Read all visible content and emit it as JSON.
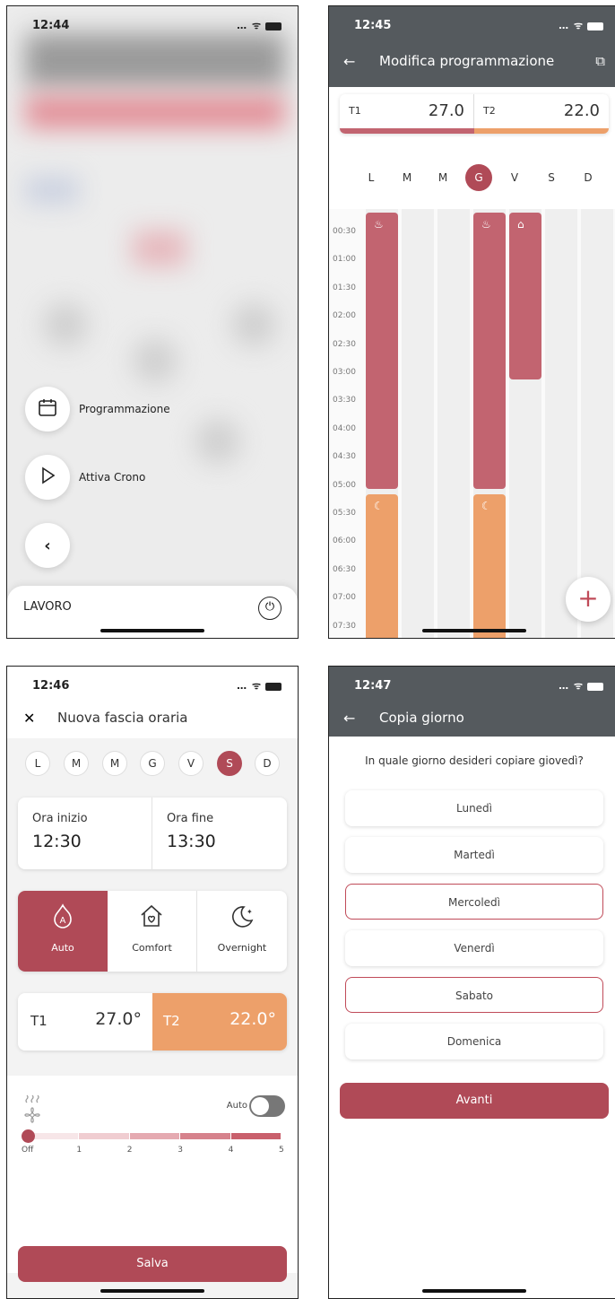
{
  "colors": {
    "primary": "#b04a57",
    "red": "#c26470",
    "orange": "#eda06a",
    "header": "#555a5e"
  },
  "p1": {
    "time": "12:44",
    "fab1_label": "Programmazione",
    "fab2_label": "Attiva Crono",
    "bottom_label": "LAVORO"
  },
  "p2": {
    "time": "12:45",
    "title": "Modifica programmazione",
    "t1_label": "T1",
    "t1_value": "27.0",
    "t2_label": "T2",
    "t2_value": "22.0",
    "days": [
      "L",
      "M",
      "M",
      "G",
      "V",
      "S",
      "D"
    ],
    "selected_day": "G",
    "times": [
      "00:30",
      "01:00",
      "01:30",
      "02:00",
      "02:30",
      "03:00",
      "03:30",
      "04:00",
      "04:30",
      "05:00",
      "05:30",
      "06:00",
      "06:30",
      "07:00",
      "07:30"
    ]
  },
  "p3": {
    "time": "12:46",
    "title": "Nuova fascia oraria",
    "days": [
      "L",
      "M",
      "M",
      "G",
      "V",
      "S",
      "D"
    ],
    "selected_day": "S",
    "start_label": "Ora inizio",
    "start_value": "12:30",
    "end_label": "Ora fine",
    "end_value": "13:30",
    "modes": [
      "Auto",
      "Comfort",
      "Overnight"
    ],
    "selected_mode": "Auto",
    "t1_label": "T1",
    "t1_value": "27.0°",
    "t2_label": "T2",
    "t2_value": "22.0°",
    "fan_auto_label": "Auto",
    "fan_levels": [
      "Off",
      "1",
      "2",
      "3",
      "4",
      "5"
    ],
    "fan_level_value": 0,
    "save_label": "Salva"
  },
  "p4": {
    "time": "12:47",
    "title": "Copia giorno",
    "question": "In quale giorno desideri copiare giovedì?",
    "options": [
      "Lunedì",
      "Martedì",
      "Mercoledì",
      "Venerdì",
      "Sabato",
      "Domenica"
    ],
    "selected": [
      "Mercoledì",
      "Sabato"
    ],
    "next_label": "Avanti"
  }
}
